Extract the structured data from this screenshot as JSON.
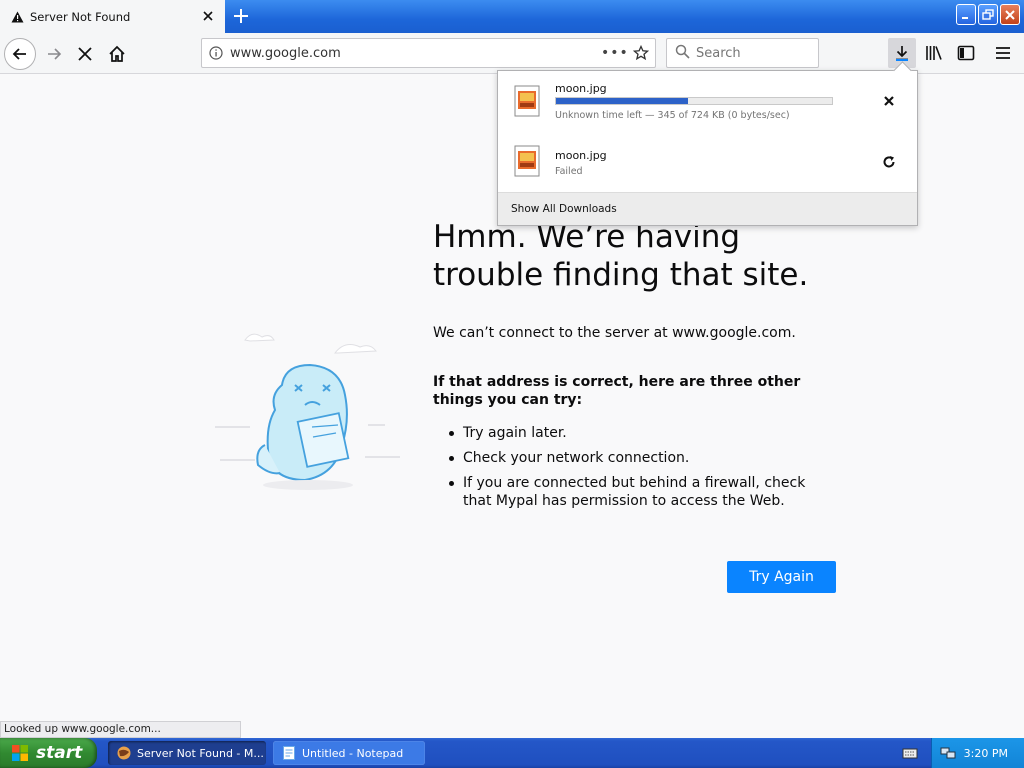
{
  "browser": {
    "tab": {
      "title": "Server Not Found"
    },
    "url": "www.google.com",
    "more_label": "•••",
    "search": {
      "placeholder": "Search"
    }
  },
  "downloads": {
    "items": [
      {
        "name": "moon.jpg",
        "status": "Unknown time left — 345 of 724 KB (0 bytes/sec)",
        "progress": 0.48,
        "action": "cancel"
      },
      {
        "name": "moon.jpg",
        "status": "Failed",
        "action": "retry"
      }
    ],
    "footer_label": "Show All Downloads"
  },
  "error_page": {
    "title": "Hmm. We’re having trouble finding that site.",
    "description": "We can’t connect to the server at www.google.com.",
    "subtitle": "If that address is correct, here are three other things you can try:",
    "suggestions": [
      "Try again later.",
      "Check your network connection.",
      "If you are connected but behind a firewall, check that Mypal has permission to access the Web."
    ],
    "try_again_label": "Try Again"
  },
  "status_bar": "Looked up www.google.com...",
  "taskbar": {
    "start_label": "start",
    "items": [
      {
        "label": "Server Not Found - M..."
      },
      {
        "label": "Untitled - Notepad"
      }
    ],
    "clock": "3:20 PM"
  },
  "colors": {
    "accent": "#0a84ff",
    "progress": "#2d62c8",
    "taskbar": "#245edb"
  }
}
